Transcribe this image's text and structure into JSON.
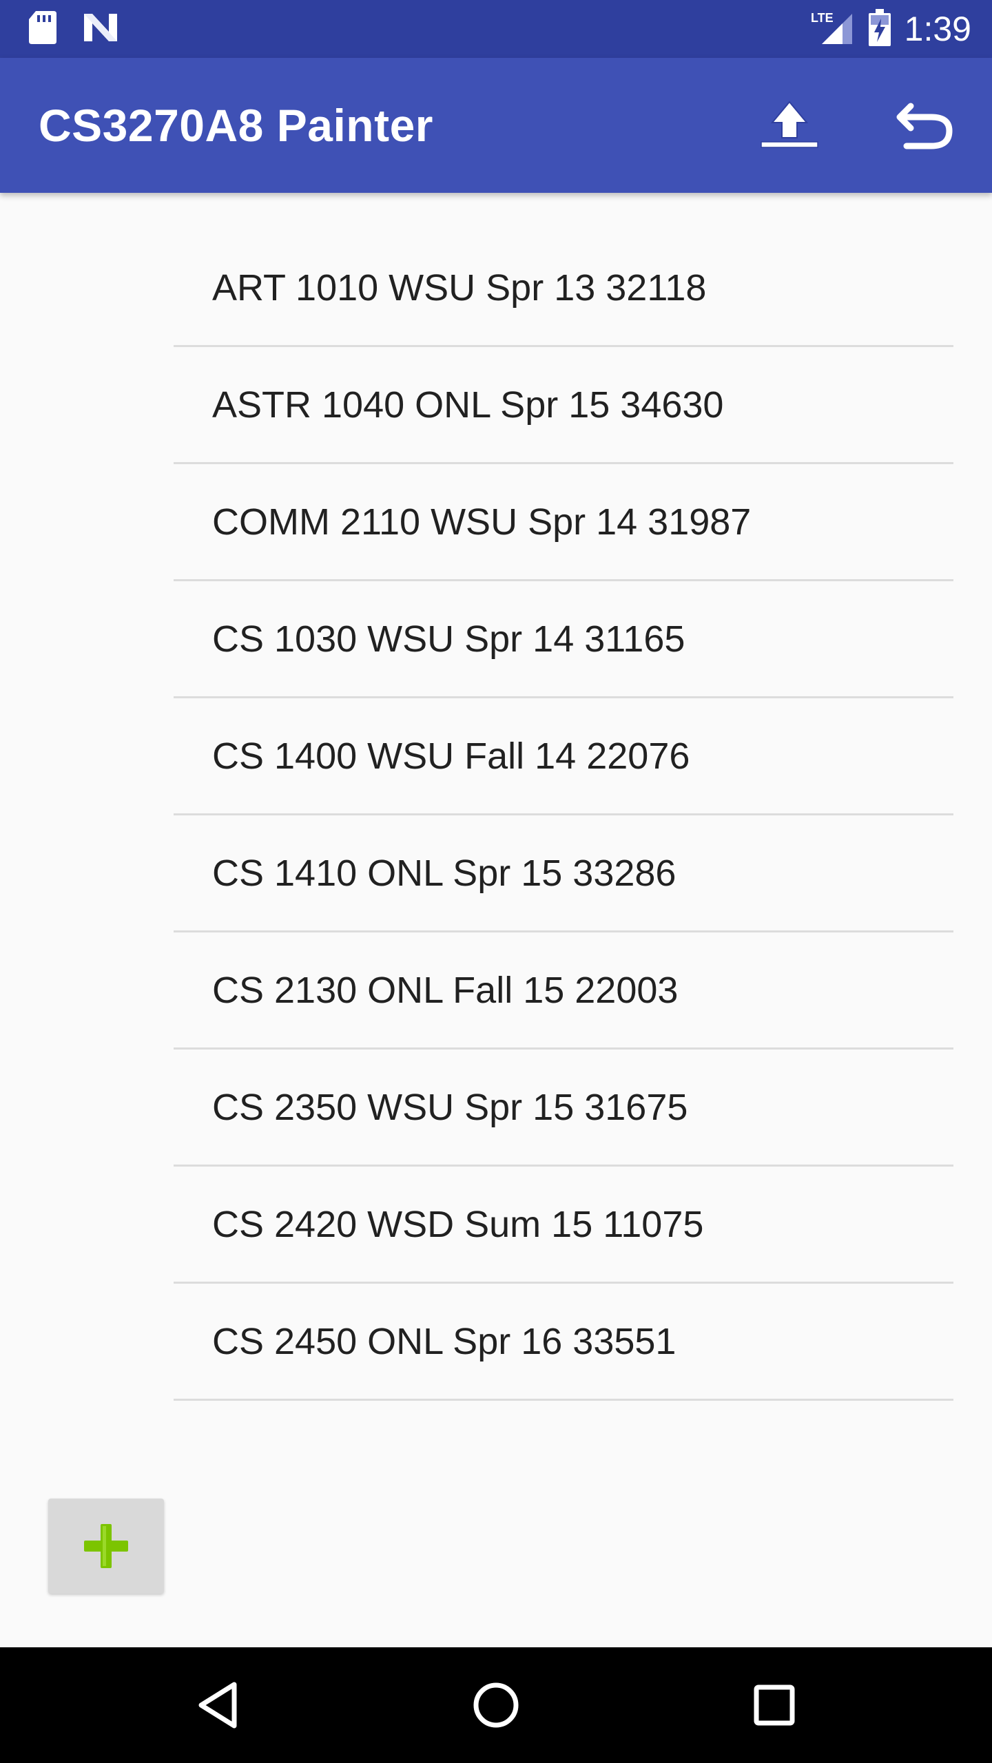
{
  "status_bar": {
    "time": "1:39",
    "network_label": "LTE",
    "icons": [
      "sd-card-icon",
      "n-notification-icon",
      "lte-signal-icon",
      "battery-charging-icon"
    ]
  },
  "app_bar": {
    "title": "CS3270A8 Painter",
    "actions": [
      "upload-icon",
      "undo-icon"
    ]
  },
  "courses": [
    {
      "label": "ART 1010 WSU Spr 13 32118"
    },
    {
      "label": "ASTR 1040 ONL Spr 15 34630"
    },
    {
      "label": "COMM 2110 WSU Spr 14 31987"
    },
    {
      "label": "CS 1030 WSU Spr 14 31165"
    },
    {
      "label": "CS 1400 WSU Fall 14 22076"
    },
    {
      "label": "CS 1410 ONL Spr 15 33286"
    },
    {
      "label": "CS 2130 ONL Fall 15 22003"
    },
    {
      "label": "CS 2350 WSU Spr 15 31675"
    },
    {
      "label": "CS 2420 WSD Sum 15 11075"
    },
    {
      "label": "CS 2450 ONL Spr 16 33551"
    }
  ],
  "add_button": {
    "icon": "plus-icon"
  },
  "nav_bar": {
    "icons": [
      "back-icon",
      "home-icon",
      "recents-icon"
    ]
  },
  "colors": {
    "status_bar": "#2f3f9e",
    "app_bar": "#3f51b5",
    "background": "#fafafa",
    "divider": "#dcdcdc",
    "plus_green": "#7cc400"
  }
}
